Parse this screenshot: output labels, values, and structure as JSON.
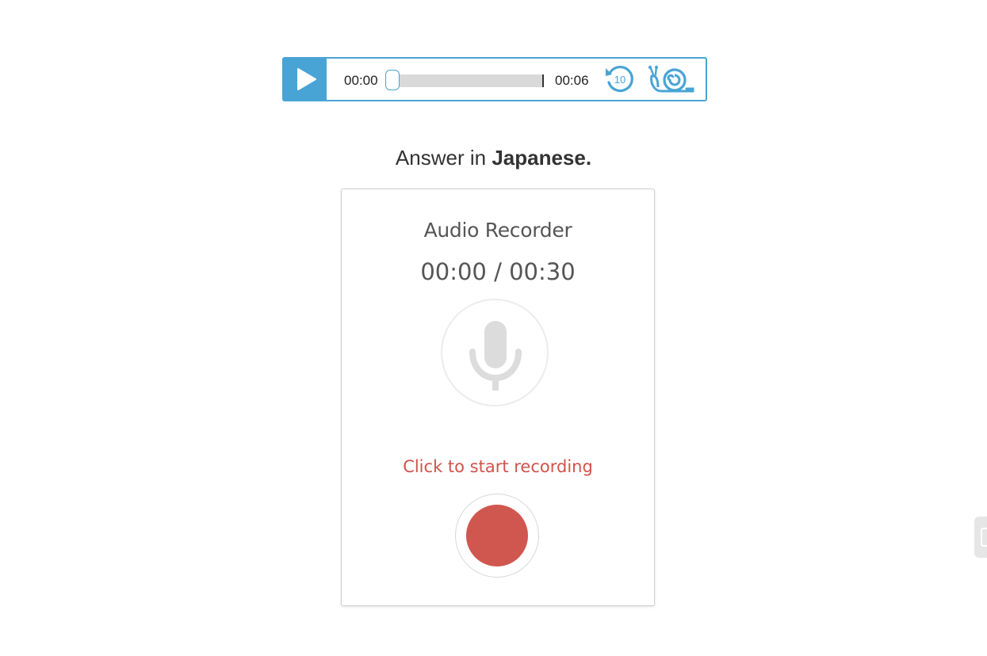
{
  "colors": {
    "accent_blue": "#48a4d5",
    "record_red": "#d0574f",
    "hint_red": "#d0534a",
    "text_dark": "#333333"
  },
  "player": {
    "current_time": "00:00",
    "total_time": "00:06",
    "progress": 0,
    "rewind_seconds": "10",
    "play_icon": "play-icon",
    "rewind_icon": "rewind-10-icon",
    "slow_icon": "snail-icon"
  },
  "instruction": {
    "prefix": "Answer in ",
    "language": "Japanese."
  },
  "recorder": {
    "title": "Audio Recorder",
    "timer": "00:00 / 00:30",
    "hint": "Click to start recording",
    "mic_icon": "microphone-icon",
    "record_icon": "record-icon"
  }
}
